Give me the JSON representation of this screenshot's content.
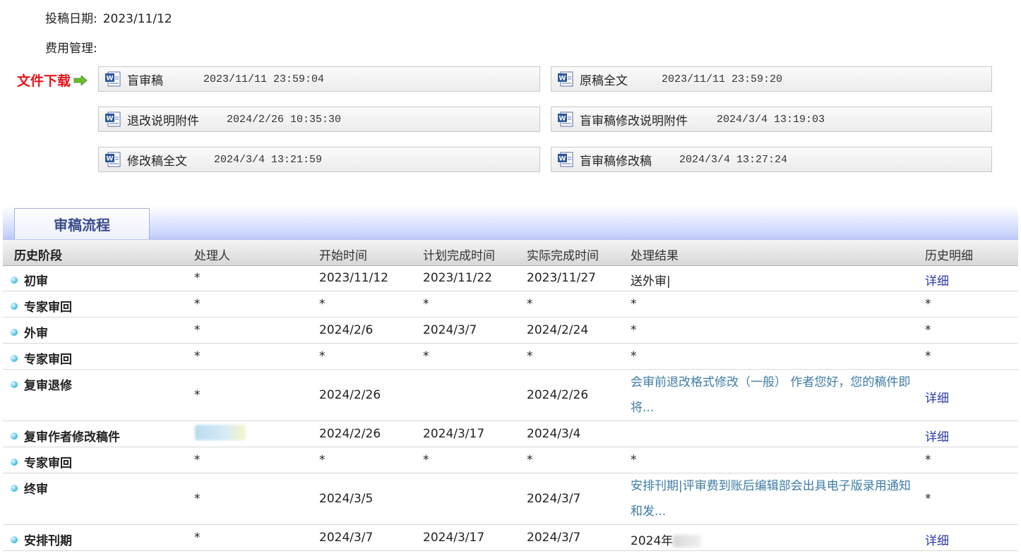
{
  "info": {
    "submit_date_label": "投稿日期:",
    "submit_date": "2023/11/12",
    "fee_label": "费用管理:"
  },
  "download": {
    "label": "文件下载",
    "files": [
      {
        "name": "盲审稿",
        "time": "2023/11/11 23:59:04"
      },
      {
        "name": "原稿全文",
        "time": "2023/11/11 23:59:20"
      },
      {
        "name": "退改说明附件",
        "time": "2024/2/26 10:35:30"
      },
      {
        "name": "盲审稿修改说明附件",
        "time": "2024/3/4 13:19:03"
      },
      {
        "name": "修改稿全文",
        "time": "2024/3/4 13:21:59"
      },
      {
        "name": "盲审稿修改稿",
        "time": "2024/3/4 13:27:24"
      }
    ]
  },
  "workflow": {
    "tab_label": "审稿流程",
    "headers": [
      "历史阶段",
      "处理人",
      "开始时间",
      "计划完成时间",
      "实际完成时间",
      "处理结果",
      "历史明细"
    ],
    "rows": [
      {
        "stage": "初审",
        "handler": "*",
        "start": "2023/11/12",
        "planned": "2023/11/22",
        "actual": "2023/11/27",
        "result": "送外审|",
        "detail": "详细"
      },
      {
        "stage": "专家审回",
        "handler": "*",
        "start": "*",
        "planned": "*",
        "actual": "*",
        "result": "*",
        "detail": "*"
      },
      {
        "stage": "外审",
        "handler": "*",
        "start": "2024/2/6",
        "planned": "2024/3/7",
        "actual": "2024/2/24",
        "result": "*",
        "detail": "*"
      },
      {
        "stage": "专家审回",
        "handler": "*",
        "start": "*",
        "planned": "*",
        "actual": "*",
        "result": "*",
        "detail": "*"
      },
      {
        "stage": "复审退修",
        "handler": "*",
        "start": "2024/2/26",
        "planned": "",
        "actual": "2024/2/26",
        "result": "会审前退改格式修改（一般） 作者您好，您的稿件即将...",
        "detail": "详细"
      },
      {
        "stage": "复审作者修改稿件",
        "handler": "",
        "start": "2024/2/26",
        "planned": "2024/3/17",
        "actual": "2024/3/4",
        "result": "",
        "detail": "详细"
      },
      {
        "stage": "专家审回",
        "handler": "*",
        "start": "*",
        "planned": "*",
        "actual": "*",
        "result": "*",
        "detail": "*"
      },
      {
        "stage": "终审",
        "handler": "*",
        "start": "2024/3/5",
        "planned": "",
        "actual": "2024/3/7",
        "result": "安排刊期|评审费到账后编辑部会出具电子版录用通知和发...",
        "detail": "*"
      },
      {
        "stage": "安排刊期",
        "handler": "*",
        "start": "2024/3/7",
        "planned": "2024/3/17",
        "actual": "2024/3/7",
        "result": "2024年",
        "detail": "详细"
      }
    ]
  }
}
